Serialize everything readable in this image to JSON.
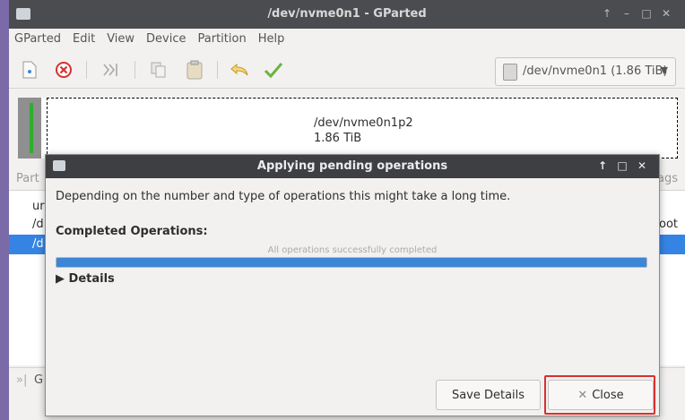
{
  "window": {
    "title": "/dev/nvme0n1 - GParted",
    "controls": [
      "↑",
      "–",
      "□",
      "✕"
    ]
  },
  "menu": [
    "GParted",
    "Edit",
    "View",
    "Device",
    "Partition",
    "Help"
  ],
  "toolbar": {
    "icons": [
      "new-icon",
      "delete-icon",
      "resize-icon",
      "copy-icon",
      "paste-icon",
      "undo-icon",
      "apply-icon"
    ],
    "device_label": "/dev/nvme0n1 (1.86 TiB)"
  },
  "graph": {
    "partition_name": "/dev/nvme0n1p2",
    "partition_size": "1.86 TiB"
  },
  "background_list": {
    "header_left": "Part",
    "header_right": "ags",
    "rows": [
      {
        "left": "ur",
        "right": ""
      },
      {
        "left": "/d",
        "right": "boot"
      },
      {
        "left": "/d",
        "right": ""
      }
    ]
  },
  "statusbar": {
    "text": "G"
  },
  "dialog": {
    "title": "Applying pending operations",
    "controls": [
      "↑",
      "□",
      "✕"
    ],
    "message": "Depending on the number and type of operations this might take a long time.",
    "completed_label": "Completed Operations:",
    "progress_text": "All operations successfully completed",
    "progress_fraction": 1.0,
    "details_label": "Details",
    "save_button": "Save Details",
    "close_button": "Close"
  },
  "colors": {
    "accent": "#3d86d6",
    "highlight": "#d83030",
    "titlebar": "#4b4c50"
  }
}
